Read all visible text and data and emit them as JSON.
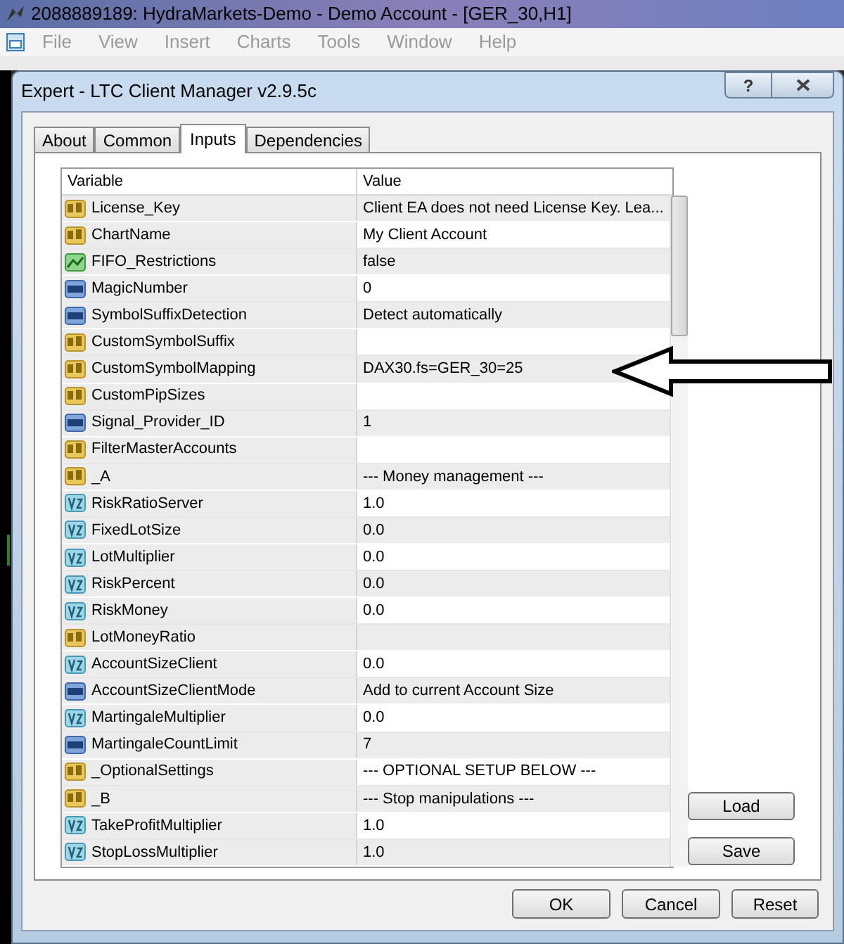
{
  "window": {
    "title": "2088889189: HydraMarkets-Demo - Demo Account - [GER_30,H1]"
  },
  "menu": [
    "File",
    "View",
    "Insert",
    "Charts",
    "Tools",
    "Window",
    "Help"
  ],
  "dialog": {
    "title": "Expert - LTC Client Manager v2.9.5c",
    "help": "?"
  },
  "tabs": [
    {
      "label": "About",
      "selected": false
    },
    {
      "label": "Common",
      "selected": false
    },
    {
      "label": "Inputs",
      "selected": true
    },
    {
      "label": "Dependencies",
      "selected": false
    }
  ],
  "table": {
    "columns": [
      "Variable",
      "Value"
    ],
    "rows": [
      {
        "kind": "text",
        "variable": "License_Key",
        "value": "Client EA does not need License Key. Lea..."
      },
      {
        "kind": "text",
        "variable": "ChartName",
        "value": "My Client Account"
      },
      {
        "kind": "bool",
        "variable": "FIFO_Restrictions",
        "value": "false"
      },
      {
        "kind": "int",
        "variable": "MagicNumber",
        "value": "0"
      },
      {
        "kind": "int",
        "variable": "SymbolSuffixDetection",
        "value": "Detect automatically"
      },
      {
        "kind": "text",
        "variable": "CustomSymbolSuffix"
      },
      {
        "kind": "text",
        "variable": "CustomSymbolMapping",
        "value": "DAX30.fs=GER_30=25"
      },
      {
        "kind": "text",
        "variable": "CustomPipSizes"
      },
      {
        "kind": "int",
        "variable": "Signal_Provider_ID",
        "value": "1"
      },
      {
        "kind": "text",
        "variable": "FilterMasterAccounts"
      },
      {
        "kind": "text",
        "variable": "_A",
        "value": "--- Money management ---"
      },
      {
        "kind": "double",
        "variable": "RiskRatioServer",
        "value": "1.0"
      },
      {
        "kind": "double",
        "variable": "FixedLotSize",
        "value": "0.0"
      },
      {
        "kind": "double",
        "variable": "LotMultiplier",
        "value": "0.0"
      },
      {
        "kind": "double",
        "variable": "RiskPercent",
        "value": "0.0"
      },
      {
        "kind": "double",
        "variable": "RiskMoney",
        "value": "0.0"
      },
      {
        "kind": "text",
        "variable": "LotMoneyRatio"
      },
      {
        "kind": "double",
        "variable": "AccountSizeClient",
        "value": "0.0"
      },
      {
        "kind": "int",
        "variable": "AccountSizeClientMode",
        "value": "Add to current Account Size"
      },
      {
        "kind": "double",
        "variable": "MartingaleMultiplier",
        "value": "0.0"
      },
      {
        "kind": "int",
        "variable": "MartingaleCountLimit",
        "value": "7"
      },
      {
        "kind": "text",
        "variable": "_OptionalSettings",
        "value": "--- OPTIONAL SETUP BELOW ---"
      },
      {
        "kind": "text",
        "variable": "_B",
        "value": "--- Stop manipulations ---"
      },
      {
        "kind": "double",
        "variable": "TakeProfitMultiplier",
        "value": "1.0"
      },
      {
        "kind": "double",
        "variable": "StopLossMultiplier",
        "value": "1.0"
      }
    ]
  },
  "side_buttons": [
    "Load",
    "Save"
  ],
  "buttons": [
    "OK",
    "Cancel",
    "Reset"
  ]
}
